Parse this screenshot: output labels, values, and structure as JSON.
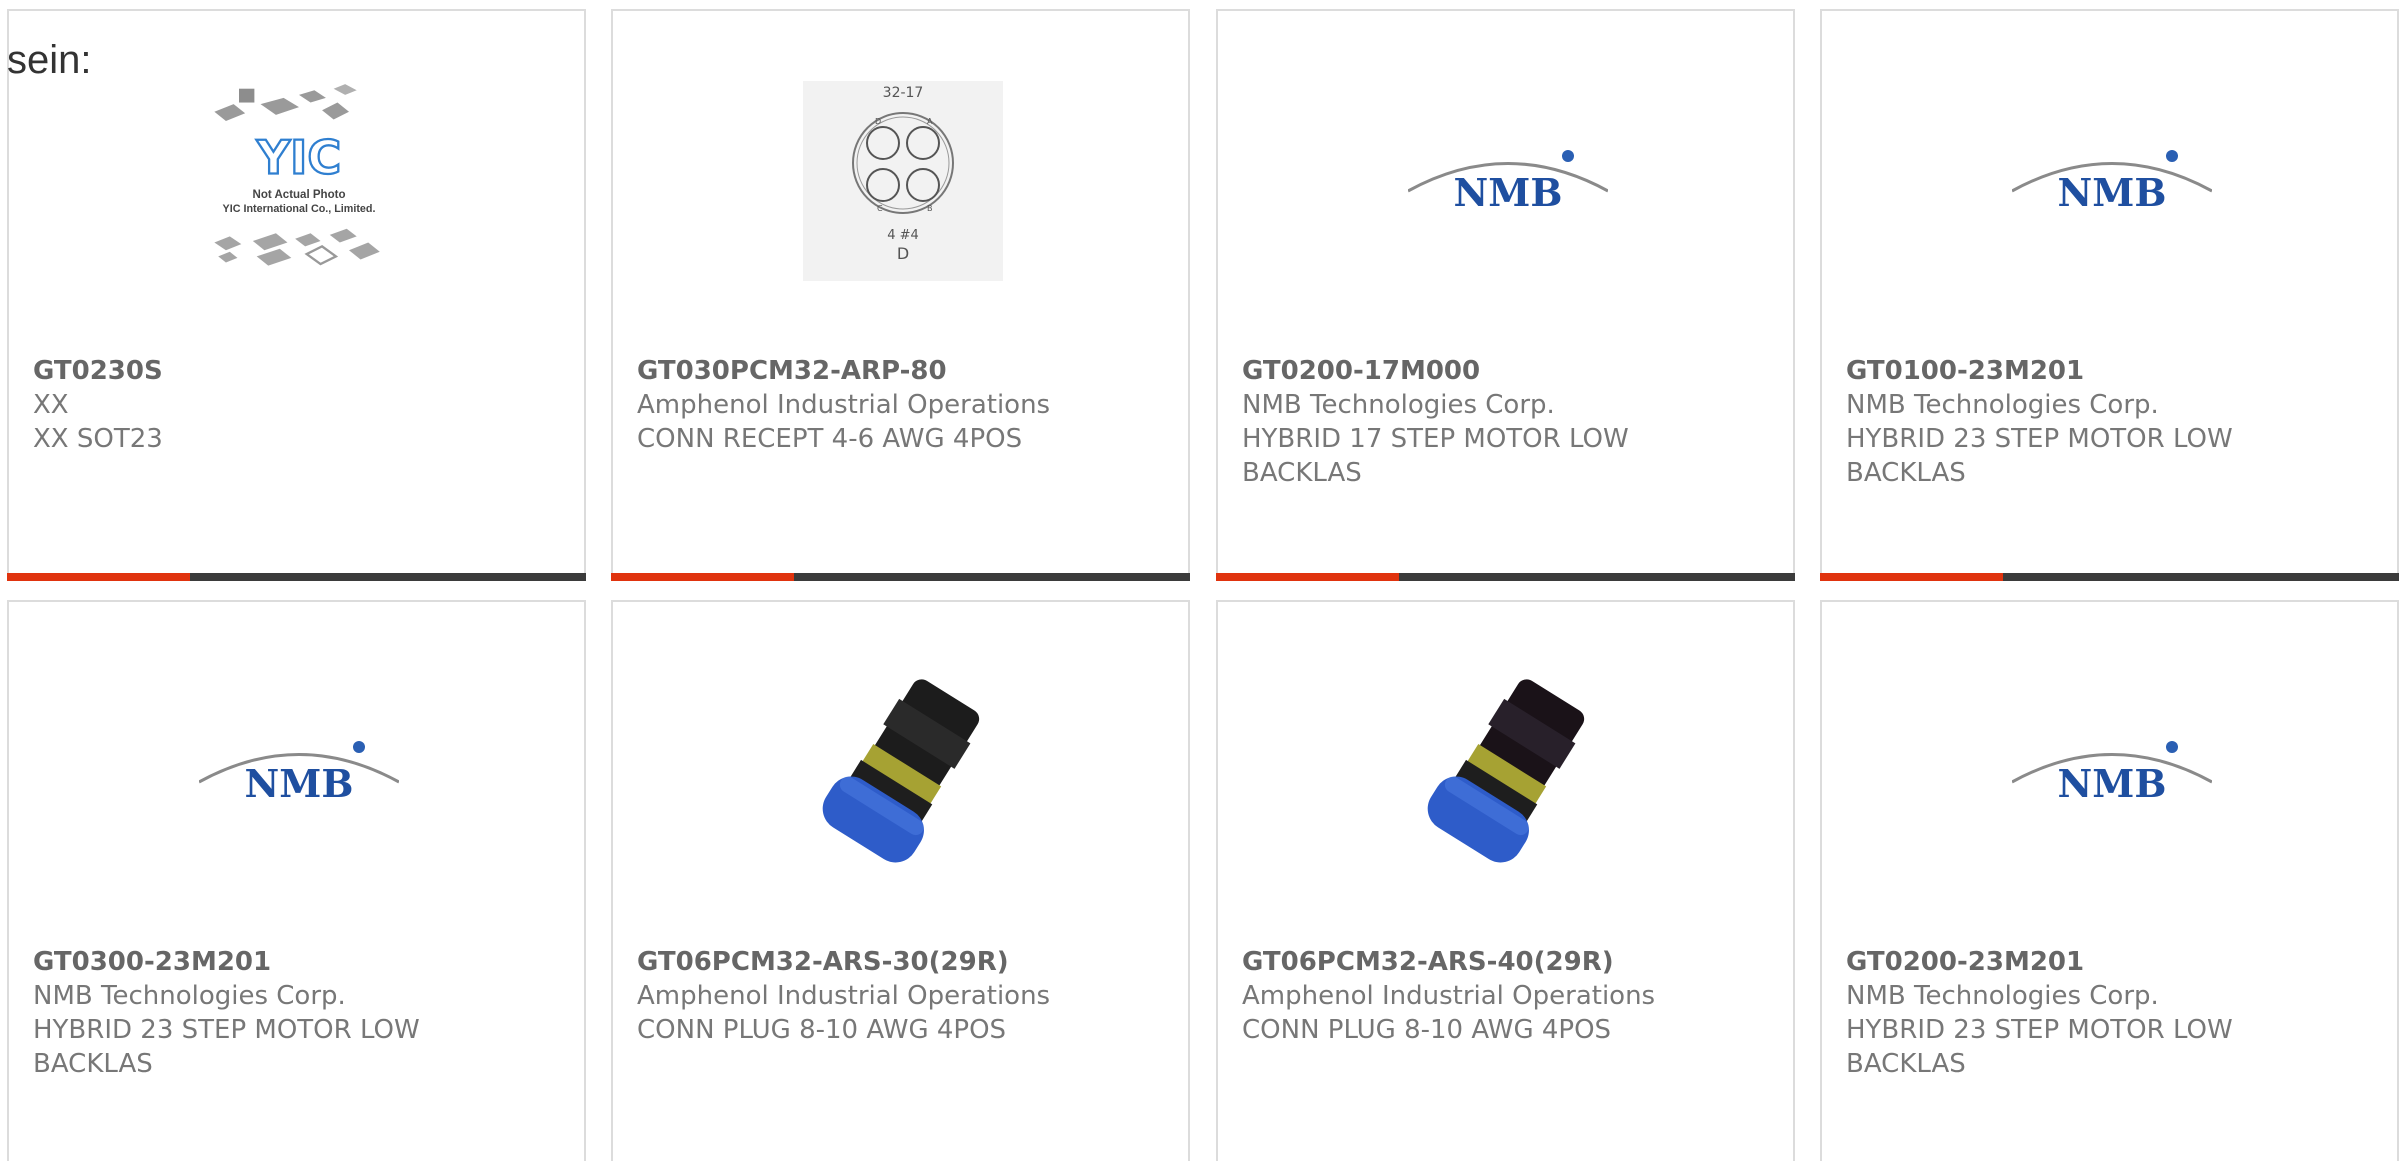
{
  "intro_text": "sein:",
  "products": [
    {
      "part_number": "GT0230S",
      "manufacturer": "XX",
      "description": "XX SOT23",
      "image": "yic-placeholder",
      "image_caption_1": "Not Actual Photo",
      "image_caption_2": "YIC International Co., Limited.",
      "image_logo": "YIC"
    },
    {
      "part_number": "GT030PCM32-ARP-80",
      "manufacturer": "Amphenol Industrial Operations",
      "description": "CONN RECEPT 4-6 AWG 4POS",
      "image": "connector-diagram",
      "diagram_top": "32-17",
      "diagram_bottom": "4 #4",
      "diagram_letter": "D",
      "pins": [
        "D",
        "A",
        "C",
        "B"
      ]
    },
    {
      "part_number": "GT0200-17M000",
      "manufacturer": "NMB Technologies Corp.",
      "description": "HYBRID 17 STEP MOTOR LOW BACKLAS",
      "image": "nmb-logo",
      "logo_text": "NMB"
    },
    {
      "part_number": "GT0100-23M201",
      "manufacturer": "NMB Technologies Corp.",
      "description": "HYBRID 23 STEP MOTOR LOW BACKLAS",
      "image": "nmb-logo",
      "logo_text": "NMB"
    },
    {
      "part_number": "GT0300-23M201",
      "manufacturer": "NMB Technologies Corp.",
      "description": "HYBRID 23 STEP MOTOR LOW BACKLAS",
      "image": "nmb-logo",
      "logo_text": "NMB"
    },
    {
      "part_number": "GT06PCM32-ARS-30(29R)",
      "manufacturer": "Amphenol Industrial Operations",
      "description": "CONN PLUG 8-10 AWG 4POS",
      "image": "connector-plug-photo"
    },
    {
      "part_number": "GT06PCM32-ARS-40(29R)",
      "manufacturer": "Amphenol Industrial Operations",
      "description": "CONN PLUG 8-10 AWG 4POS",
      "image": "connector-plug-photo"
    },
    {
      "part_number": "GT0200-23M201",
      "manufacturer": "NMB Technologies Corp.",
      "description": "HYBRID 23 STEP MOTOR LOW BACKLAS",
      "image": "nmb-logo",
      "logo_text": "NMB"
    }
  ],
  "colors": {
    "accent": "#e0330e",
    "bar_dark": "#3b3b3b",
    "card_border": "#dcdcdc",
    "nmb_blue": "#1f4fa0"
  }
}
